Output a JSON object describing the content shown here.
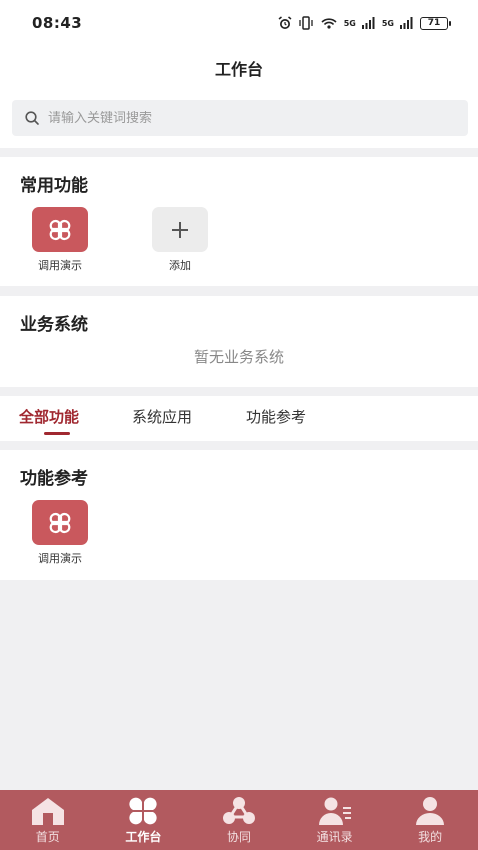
{
  "status_bar": {
    "time": "08:43",
    "network_1": "5G",
    "network_2": "5G",
    "battery": "71"
  },
  "header": {
    "title": "工作台"
  },
  "search": {
    "placeholder": "请输入关键词搜索"
  },
  "common_functions": {
    "title": "常用功能",
    "items": [
      {
        "label": "调用演示",
        "icon": "four-petal-icon"
      },
      {
        "label": "添加",
        "icon": "plus-icon"
      }
    ]
  },
  "business_systems": {
    "title": "业务系统",
    "empty_text": "暂无业务系统"
  },
  "tabs": [
    {
      "label": "全部功能",
      "active": true
    },
    {
      "label": "系统应用",
      "active": false
    },
    {
      "label": "功能参考",
      "active": false
    }
  ],
  "function_reference": {
    "title": "功能参考",
    "items": [
      {
        "label": "调用演示",
        "icon": "four-petal-icon"
      }
    ]
  },
  "bottom_nav": [
    {
      "label": "首页",
      "icon": "home-icon",
      "active": false
    },
    {
      "label": "工作台",
      "icon": "workbench-icon",
      "active": true
    },
    {
      "label": "协同",
      "icon": "collaboration-icon",
      "active": false
    },
    {
      "label": "通讯录",
      "icon": "contacts-icon",
      "active": false
    },
    {
      "label": "我的",
      "icon": "profile-icon",
      "active": false
    }
  ],
  "colors": {
    "accent": "#a02830",
    "tile_red": "#c9585d",
    "nav_bg": "#b25a5f"
  }
}
